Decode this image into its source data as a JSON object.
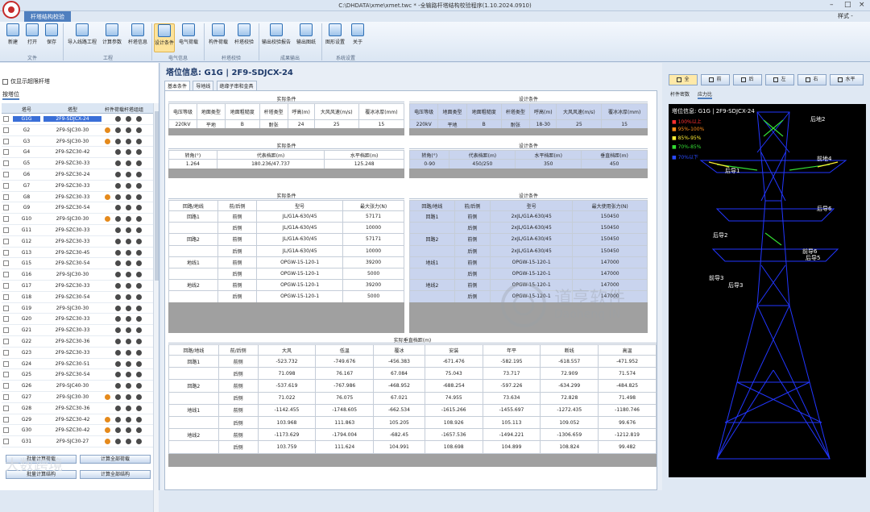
{
  "title_bar": {
    "app_tab": "杆塔结构校验",
    "window_title": "C:\\DHDATA\\xme\\xmet.twc * -全输路杆塔结构校验程序(1.10.2024.0910)",
    "style_label": "样式 -"
  },
  "ribbon": {
    "groups": [
      {
        "label": "文件",
        "buttons": [
          "新建",
          "打开",
          "保存"
        ]
      },
      {
        "label": "工程",
        "buttons": [
          "导入线路工程",
          "计算参数",
          "杆塔信息"
        ]
      },
      {
        "label": "电气信息",
        "buttons": [
          "设计条件",
          "电气荷载"
        ]
      },
      {
        "label": "杆塔校验",
        "buttons": [
          "构件荷载",
          "杆塔校验"
        ]
      },
      {
        "label": "成果输出",
        "buttons": [
          "输出校验报告",
          "输出图纸"
        ]
      },
      {
        "label": "系统设置",
        "buttons": [
          "图形设置",
          "关于"
        ]
      }
    ]
  },
  "left_panel": {
    "show_all": "仅显示超限杆塔",
    "locate_label": "按塔位",
    "headers": {
      "no": "塔号",
      "type": "塔型",
      "status": "杆件荷载杆塔组组"
    },
    "rows": [
      {
        "no": "G1G",
        "type": "2F9-SDJCX-24",
        "dots": "eddd",
        "sel": true
      },
      {
        "no": "G2",
        "type": "2F9-SJC30-30",
        "dots": "oddd"
      },
      {
        "no": "G3",
        "type": "2F9-SJC30-30",
        "dots": "oddd"
      },
      {
        "no": "G4",
        "type": "2F9-SZC30-42",
        "dots": "eddd"
      },
      {
        "no": "G5",
        "type": "2F9-SZC30-33",
        "dots": "eddd"
      },
      {
        "no": "G6",
        "type": "2F9-SZC30-24",
        "dots": "eddd"
      },
      {
        "no": "G7",
        "type": "2F9-SZC30-33",
        "dots": "eddd"
      },
      {
        "no": "G8",
        "type": "2F9-SZC30-33",
        "dots": "oddd"
      },
      {
        "no": "G9",
        "type": "2F9-SZC30-54",
        "dots": "eddd"
      },
      {
        "no": "G10",
        "type": "2F9-SJC30-30",
        "dots": "oddd"
      },
      {
        "no": "G11",
        "type": "2F9-SZC30-33",
        "dots": "eddd"
      },
      {
        "no": "G12",
        "type": "2F9-SZC30-33",
        "dots": "eddd"
      },
      {
        "no": "G13",
        "type": "2F9-SZC30-45",
        "dots": "eddd"
      },
      {
        "no": "G15",
        "type": "2F9-SZC30-54",
        "dots": "eddd"
      },
      {
        "no": "G16",
        "type": "2F9-SJC30-30",
        "dots": "eddd"
      },
      {
        "no": "G17",
        "type": "2F9-SZC30-33",
        "dots": "eddd"
      },
      {
        "no": "G18",
        "type": "2F9-SZC30-54",
        "dots": "eddd"
      },
      {
        "no": "G19",
        "type": "2F9-SJC30-30",
        "dots": "eddd"
      },
      {
        "no": "G20",
        "type": "2F9-SZC30-33",
        "dots": "eddd"
      },
      {
        "no": "G21",
        "type": "2F9-SZC30-33",
        "dots": "eddd"
      },
      {
        "no": "G22",
        "type": "2F9-SZC30-36",
        "dots": "eddd"
      },
      {
        "no": "G23",
        "type": "2F9-SZC30-33",
        "dots": "eddd"
      },
      {
        "no": "G24",
        "type": "2F9-SZC30-51",
        "dots": "eddd"
      },
      {
        "no": "G25",
        "type": "2F9-SZC30-54",
        "dots": "eddd"
      },
      {
        "no": "G26",
        "type": "2F9-SJC40-30",
        "dots": "eddd"
      },
      {
        "no": "G27",
        "type": "2F9-SJC30-30",
        "dots": "oddd"
      },
      {
        "no": "G28",
        "type": "2F9-SZC30-36",
        "dots": "eddd"
      },
      {
        "no": "G29",
        "type": "2F9-SZC30-42",
        "dots": "oddd"
      },
      {
        "no": "G30",
        "type": "2F9-SZC30-42",
        "dots": "oddd"
      },
      {
        "no": "G31",
        "type": "2F9-SJC30-27",
        "dots": "oddd"
      }
    ],
    "btn_batch_load": "批量计算荷载",
    "btn_calc_all": "计算全部荷载",
    "btn_batch_struct": "批量计算结构",
    "btn_all_struct": "计算全部结构"
  },
  "center": {
    "tower_info": "塔位信息: G1G | 2F9-SDJCX-24",
    "tabs": [
      "基本条件",
      "导地线",
      "绝缘子串和金具"
    ],
    "actual_cond": {
      "title": "实际条件",
      "headers": [
        "电压等级",
        "地面类型",
        "地面粗糙度",
        "杆塔类型",
        "呼高(m)",
        "大风风速(m/s)",
        "覆冰冰厚(mm)"
      ],
      "values": [
        "220kV",
        "平地",
        "B",
        "耐张",
        "24",
        "25",
        "15"
      ]
    },
    "design_cond": {
      "title": "设计条件",
      "headers": [
        "电压等级",
        "地面类型",
        "地面粗糙度",
        "杆塔类型",
        "呼高(m)",
        "大风风速(m/s)",
        "覆冰冰厚(mm)"
      ],
      "values": [
        "220kV",
        "平地",
        "B",
        "耐张",
        "18-30",
        "25",
        "15"
      ]
    },
    "actual_span": {
      "title": "实际条件",
      "headers": [
        "转角(°)",
        "代表档距(m)",
        "水平档距(m)"
      ],
      "values": [
        "1.264",
        "180.236/47.737",
        "125.248"
      ]
    },
    "design_span": {
      "title": "设计条件",
      "headers": [
        "转角(°)",
        "代表档距(m)",
        "水平档距(m)",
        "垂直档距(m)"
      ],
      "values": [
        "0-90",
        "450/250",
        "350",
        "450"
      ]
    },
    "actual_wire": {
      "title": "实际条件",
      "headers": [
        "回路/地线",
        "前/后侧",
        "型号",
        "最大张力(N)"
      ],
      "rows": [
        [
          "回路1",
          "前侧",
          "JL/G1A-630/45",
          "57171"
        ],
        [
          "",
          "后侧",
          "JL/G1A-630/45",
          "10000"
        ],
        [
          "回路2",
          "前侧",
          "JL/G1A-630/45",
          "57171"
        ],
        [
          "",
          "后侧",
          "JL/G1A-630/45",
          "10000"
        ],
        [
          "地线1",
          "前侧",
          "OPGW-15-120-1",
          "39200"
        ],
        [
          "",
          "后侧",
          "OPGW-15-120-1",
          "5000"
        ],
        [
          "地线2",
          "前侧",
          "OPGW-15-120-1",
          "39200"
        ],
        [
          "",
          "后侧",
          "OPGW-15-120-1",
          "5000"
        ]
      ]
    },
    "design_wire": {
      "title": "设计条件",
      "headers": [
        "回路/地线",
        "前/后侧",
        "型号",
        "最大使用张力(N)"
      ],
      "rows": [
        [
          "回路1",
          "前侧",
          "2xJL/G1A-630/45",
          "150450"
        ],
        [
          "",
          "后侧",
          "2xJL/G1A-630/45",
          "150450"
        ],
        [
          "回路2",
          "前侧",
          "2xJL/G1A-630/45",
          "150450"
        ],
        [
          "",
          "后侧",
          "2xJL/G1A-630/45",
          "150450"
        ],
        [
          "地线1",
          "前侧",
          "OPGW-15-120-1",
          "147000"
        ],
        [
          "",
          "后侧",
          "OPGW-15-120-1",
          "147000"
        ],
        [
          "地线2",
          "前侧",
          "OPGW-15-120-1",
          "147000"
        ],
        [
          "",
          "后侧",
          "OPGW-15-120-1",
          "147000"
        ]
      ]
    },
    "vertical_span": {
      "title": "实际垂直档距(m)",
      "headers": [
        "回路/地线",
        "前/后侧",
        "大风",
        "低温",
        "覆冰",
        "安装",
        "年平",
        "断线",
        "高温"
      ],
      "rows": [
        [
          "回路1",
          "前侧",
          "-523.732",
          "-749.676",
          "-456.383",
          "-671.476",
          "-582.195",
          "-618.557",
          "-471.952"
        ],
        [
          "",
          "后侧",
          "71.098",
          "76.167",
          "67.084",
          "75.043",
          "73.717",
          "72.909",
          "71.574"
        ],
        [
          "回路2",
          "前侧",
          "-537.619",
          "-767.986",
          "-468.952",
          "-688.254",
          "-597.226",
          "-634.299",
          "-484.825"
        ],
        [
          "",
          "后侧",
          "71.022",
          "76.075",
          "67.021",
          "74.955",
          "73.634",
          "72.828",
          "71.498"
        ],
        [
          "地线1",
          "前侧",
          "-1142.455",
          "-1748.605",
          "-662.534",
          "-1615.266",
          "-1455.697",
          "-1272.435",
          "-1180.746"
        ],
        [
          "",
          "后侧",
          "103.968",
          "111.863",
          "105.205",
          "108.926",
          "105.113",
          "109.052",
          "99.676"
        ],
        [
          "地线2",
          "前侧",
          "-1173.629",
          "-1794.004",
          "-682.45",
          "-1657.536",
          "-1494.221",
          "-1306.659",
          "-1212.819"
        ],
        [
          "",
          "后侧",
          "103.759",
          "111.624",
          "104.991",
          "108.698",
          "104.899",
          "108.824",
          "99.482"
        ]
      ]
    }
  },
  "right_panel": {
    "view_buttons": [
      "全",
      "前",
      "后",
      "左",
      "右",
      "水平"
    ],
    "tabs": [
      "杆件密数",
      "应力比"
    ],
    "tower_info": "塔位信息: G1G | 2F9-SDJCX-24",
    "legend": [
      {
        "label": "100%以上",
        "color": "#ff3030"
      },
      {
        "label": "95%-100%",
        "color": "#ff8c1a"
      },
      {
        "label": "85%-95%",
        "color": "#ffee33"
      },
      {
        "label": "70%-85%",
        "color": "#33dd33"
      },
      {
        "label": "70%以下",
        "color": "#2a4bff"
      }
    ],
    "labels": [
      "后地2",
      "前地4",
      "后导1",
      "后导6",
      "后导2",
      "前导6",
      "后导5",
      "前导3",
      "后导3"
    ]
  },
  "watermark": {
    "text": "道亨软件",
    "sub": "Daoheng IN",
    "brand": "大数跨境"
  }
}
